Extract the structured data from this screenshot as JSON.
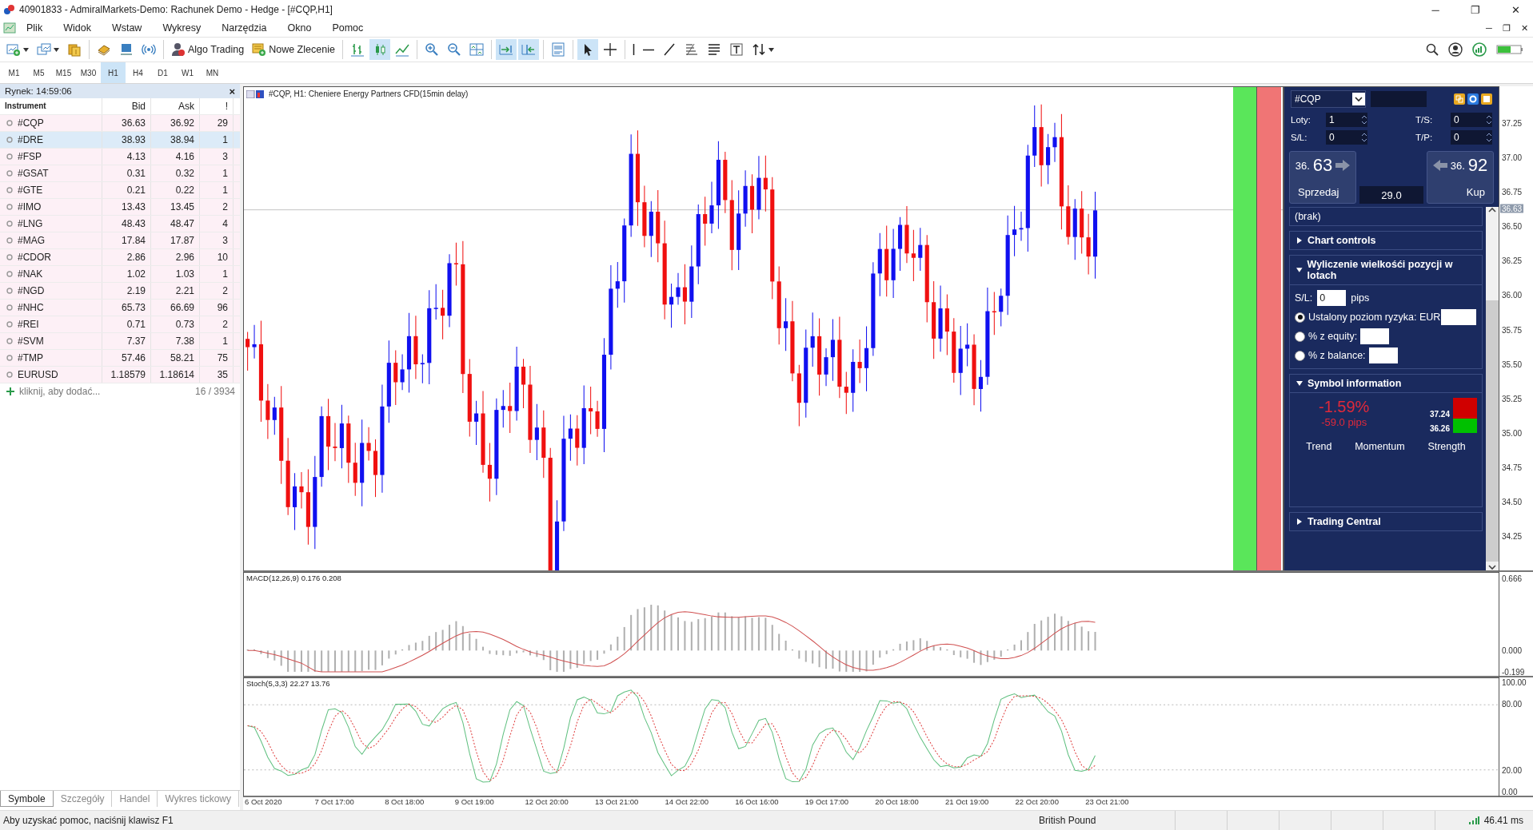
{
  "window": {
    "title": "40901833 - AdmiralMarkets-Demo: Rachunek Demo - Hedge - [#CQP,H1]",
    "controls": [
      "─",
      "❐",
      "✕"
    ]
  },
  "menu": {
    "items": [
      "Plik",
      "Widok",
      "Wstaw",
      "Wykresy",
      "Narzędzia",
      "Okno",
      "Pomoc"
    ],
    "controls": [
      "─",
      "❐",
      "✕"
    ]
  },
  "toolbar": {
    "items": [
      {
        "kind": "icon",
        "selected": false,
        "dropdown": true
      },
      {
        "kind": "icon",
        "selected": false,
        "dropdown": true
      },
      {
        "kind": "icon",
        "selected": false,
        "dropdown": false
      },
      {
        "kind": "separator"
      },
      {
        "kind": "icon",
        "selected": false,
        "dropdown": false
      },
      {
        "kind": "icon",
        "selected": false,
        "dropdown": false
      },
      {
        "kind": "icon",
        "selected": false,
        "dropdown": false
      },
      {
        "kind": "separator"
      },
      {
        "kind": "text",
        "label": "Algo Trading",
        "selected": false,
        "dropdown": false
      },
      {
        "kind": "text",
        "label": "Nowe Zlecenie",
        "selected": false,
        "dropdown": false
      },
      {
        "kind": "separator"
      },
      {
        "kind": "icon",
        "selected": false,
        "dropdown": false
      },
      {
        "kind": "icon",
        "selected": true,
        "dropdown": false
      },
      {
        "kind": "icon",
        "selected": false,
        "dropdown": false
      },
      {
        "kind": "separator"
      },
      {
        "kind": "icon",
        "selected": false,
        "dropdown": false
      },
      {
        "kind": "icon",
        "selected": false,
        "dropdown": false
      },
      {
        "kind": "icon",
        "selected": false,
        "dropdown": false
      },
      {
        "kind": "separator"
      },
      {
        "kind": "icon",
        "selected": true,
        "dropdown": false
      },
      {
        "kind": "icon",
        "selected": true,
        "dropdown": false
      },
      {
        "kind": "separator"
      },
      {
        "kind": "icon",
        "selected": false,
        "dropdown": false
      },
      {
        "kind": "separator"
      },
      {
        "kind": "icon",
        "selected": true,
        "dropdown": false
      },
      {
        "kind": "icon",
        "selected": false,
        "dropdown": false
      },
      {
        "kind": "separator"
      },
      {
        "kind": "icon",
        "selected": false,
        "dropdown": false
      },
      {
        "kind": "icon",
        "selected": false,
        "dropdown": false
      },
      {
        "kind": "icon",
        "selected": false,
        "dropdown": false
      },
      {
        "kind": "icon",
        "selected": false,
        "dropdown": false
      },
      {
        "kind": "icon",
        "selected": false,
        "dropdown": false
      },
      {
        "kind": "icon",
        "selected": false,
        "dropdown": false
      },
      {
        "kind": "icon",
        "selected": false,
        "dropdown": true
      }
    ]
  },
  "timeframes": [
    {
      "label": "M1",
      "selected": false
    },
    {
      "label": "M5",
      "selected": false
    },
    {
      "label": "M15",
      "selected": false
    },
    {
      "label": "M30",
      "selected": false
    },
    {
      "label": "H1",
      "selected": true
    },
    {
      "label": "H4",
      "selected": false
    },
    {
      "label": "D1",
      "selected": false
    },
    {
      "label": "W1",
      "selected": false
    },
    {
      "label": "MN",
      "selected": false
    }
  ],
  "market_watch": {
    "title": "Rynek: 14:59:06",
    "close": "×",
    "columns": [
      "Instrument",
      "Bid",
      "Ask",
      "!"
    ],
    "rows": [
      {
        "symbol": "#CQP",
        "bid": "36.63",
        "ask": "36.92",
        "spread": "29",
        "selected": false
      },
      {
        "symbol": "#DRE",
        "bid": "38.93",
        "ask": "38.94",
        "spread": "1",
        "selected": true
      },
      {
        "symbol": "#FSP",
        "bid": "4.13",
        "ask": "4.16",
        "spread": "3",
        "selected": false
      },
      {
        "symbol": "#GSAT",
        "bid": "0.31",
        "ask": "0.32",
        "spread": "1",
        "selected": false
      },
      {
        "symbol": "#GTE",
        "bid": "0.21",
        "ask": "0.22",
        "spread": "1",
        "selected": false
      },
      {
        "symbol": "#IMO",
        "bid": "13.43",
        "ask": "13.45",
        "spread": "2",
        "selected": false
      },
      {
        "symbol": "#LNG",
        "bid": "48.43",
        "ask": "48.47",
        "spread": "4",
        "selected": false
      },
      {
        "symbol": "#MAG",
        "bid": "17.84",
        "ask": "17.87",
        "spread": "3",
        "selected": false
      },
      {
        "symbol": "#CDOR",
        "bid": "2.86",
        "ask": "2.96",
        "spread": "10",
        "selected": false
      },
      {
        "symbol": "#NAK",
        "bid": "1.02",
        "ask": "1.03",
        "spread": "1",
        "selected": false
      },
      {
        "symbol": "#NGD",
        "bid": "2.19",
        "ask": "2.21",
        "spread": "2",
        "selected": false
      },
      {
        "symbol": "#NHC",
        "bid": "65.73",
        "ask": "66.69",
        "spread": "96",
        "selected": false
      },
      {
        "symbol": "#REI",
        "bid": "0.71",
        "ask": "0.73",
        "spread": "2",
        "selected": false
      },
      {
        "symbol": "#SVM",
        "bid": "7.37",
        "ask": "7.38",
        "spread": "1",
        "selected": false
      },
      {
        "symbol": "#TMP",
        "bid": "57.46",
        "ask": "58.21",
        "spread": "75",
        "selected": false
      },
      {
        "symbol": "EURUSD",
        "bid": "1.18579",
        "ask": "1.18614",
        "spread": "35",
        "selected": false
      }
    ],
    "add_hint": "kliknij, aby dodać...",
    "count": "16 / 3934",
    "tabs": [
      {
        "label": "Symbole",
        "selected": true
      },
      {
        "label": "Szczegóły",
        "selected": false
      },
      {
        "label": "Handel",
        "selected": false
      },
      {
        "label": "Wykres tickowy",
        "selected": false
      }
    ]
  },
  "chart": {
    "title": "#CQP, H1:  Cheniere Energy Partners CFD(15min delay)",
    "price_axis": [
      "37.25",
      "37.00",
      "36.75",
      "36.50",
      "36.25",
      "36.00",
      "35.75",
      "35.50",
      "35.25",
      "35.00",
      "34.75",
      "34.50",
      "34.25"
    ],
    "current_price": "36.63",
    "macd": {
      "title": "MACD(12,26,9) 0.176 0.208",
      "axis": [
        "0.666",
        "0.000",
        "-0.199"
      ]
    },
    "stochastic": {
      "title": "Stoch(5,3,3) 22.27 13.76",
      "axis": [
        "100.00",
        "80.00",
        "20.00",
        "0.00"
      ]
    },
    "time_axis": [
      "6 Oct 2020",
      "7 Oct 17:00",
      "8 Oct 18:00",
      "9 Oct 19:00",
      "12 Oct 20:00",
      "13 Oct 21:00",
      "14 Oct 22:00",
      "16 Oct 16:00",
      "19 Oct 17:00",
      "20 Oct 18:00",
      "21 Oct 19:00",
      "22 Oct 20:00",
      "23 Oct 21:00"
    ]
  },
  "trade_panel": {
    "symbol": "#CQP",
    "fields": [
      {
        "label": "Loty:",
        "value": "1"
      },
      {
        "label": "T/S:",
        "value": "0"
      },
      {
        "label": "S/L:",
        "value": "0"
      },
      {
        "label": "T/P:",
        "value": "0"
      }
    ],
    "sell": {
      "price_prefix": "36.",
      "price_main": "63",
      "label": "Sprzedaj"
    },
    "buy": {
      "price_prefix": "36.",
      "price_main": "92",
      "label": "Kup"
    },
    "spread": "29.0",
    "sections": [
      {
        "kind": "note",
        "text": "(brak)"
      },
      {
        "kind": "collapsible",
        "title": "Chart controls",
        "expanded": false
      },
      {
        "kind": "calculator",
        "title": "Wyliczenie wielkośći pozycji w lotach",
        "expanded": true,
        "sl_label": "S/L:",
        "sl_value": "0",
        "sl_unit": "pips",
        "options": [
          {
            "label": "Ustalony poziom ryzyka: EUR",
            "selected": true
          },
          {
            "label": "% z equity:",
            "selected": false
          },
          {
            "label": "% z balance:",
            "selected": false
          }
        ]
      },
      {
        "kind": "symbol_info",
        "title": "Symbol information",
        "expanded": true,
        "change": "-1.59%",
        "pips": "-59.0 pips",
        "high": "37.24",
        "low": "36.26",
        "labels": [
          "Trend",
          "Momentum",
          "Strength"
        ]
      },
      {
        "kind": "collapsible",
        "title": "Trading Central",
        "expanded": false
      }
    ]
  },
  "status_bar": {
    "help": "Aby uzyskać pomoc, naciśnij klawisz F1",
    "profile": "British Pound",
    "ping": "46.41 ms"
  }
}
